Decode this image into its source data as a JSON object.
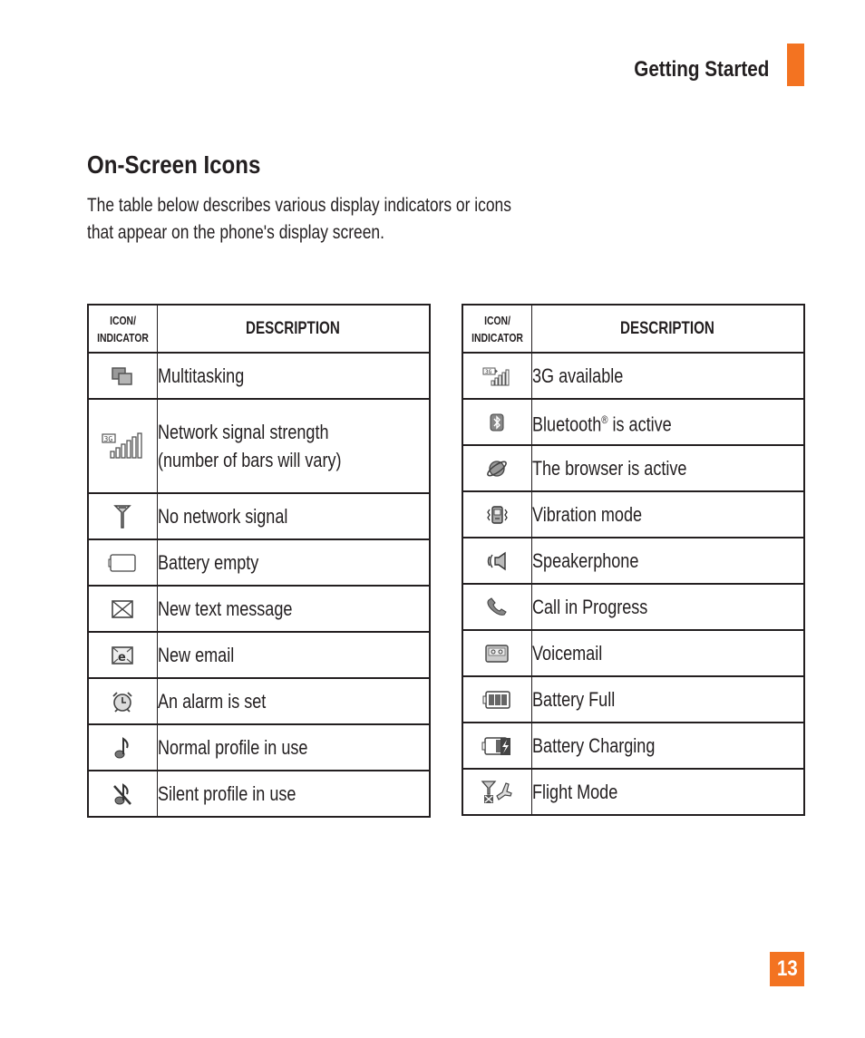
{
  "header": {
    "section_title": "Getting Started",
    "accent_color": "#f37321"
  },
  "page": {
    "title": "On-Screen Icons",
    "intro_lines": [
      "The table below describes various display indicators or icons",
      "that appear on the phone's display screen."
    ],
    "page_number": "13"
  },
  "tables": {
    "left": {
      "header_icon_line1": "ICON/",
      "header_icon_line2": "INDICATOR",
      "header_description": "DESCRIPTION",
      "rows": [
        {
          "icon": "multitasking-icon",
          "description": "Multitasking"
        },
        {
          "icon": "network-signal-strength-icon",
          "description_line1": "Network signal strength",
          "description_line2": "(number of bars will vary)"
        },
        {
          "icon": "no-network-signal-icon",
          "description": "No network signal"
        },
        {
          "icon": "battery-empty-icon",
          "description": "Battery empty"
        },
        {
          "icon": "new-text-message-icon",
          "description": "New text message"
        },
        {
          "icon": "new-email-icon",
          "description": "New email"
        },
        {
          "icon": "alarm-icon",
          "description": "An alarm is set"
        },
        {
          "icon": "normal-profile-icon",
          "description": "Normal profile in use"
        },
        {
          "icon": "silent-profile-icon",
          "description": "Silent profile in use"
        }
      ]
    },
    "right": {
      "header_icon_line1": "ICON/",
      "header_icon_line2": "INDICATOR",
      "header_description": "DESCRIPTION",
      "rows": [
        {
          "icon": "3g-available-icon",
          "description": "3G available"
        },
        {
          "icon": "bluetooth-icon",
          "description": "Bluetooth",
          "superscript": "®",
          "description_suffix": " is active"
        },
        {
          "icon": "browser-icon",
          "description": "The browser is active"
        },
        {
          "icon": "vibration-mode-icon",
          "description": "Vibration mode"
        },
        {
          "icon": "speakerphone-icon",
          "description": "Speakerphone"
        },
        {
          "icon": "call-in-progress-icon",
          "description": "Call in Progress"
        },
        {
          "icon": "voicemail-icon",
          "description": "Voicemail"
        },
        {
          "icon": "battery-full-icon",
          "description": "Battery Full"
        },
        {
          "icon": "battery-charging-icon",
          "description": "Battery Charging"
        },
        {
          "icon": "flight-mode-icon",
          "description": "Flight Mode"
        }
      ]
    }
  }
}
